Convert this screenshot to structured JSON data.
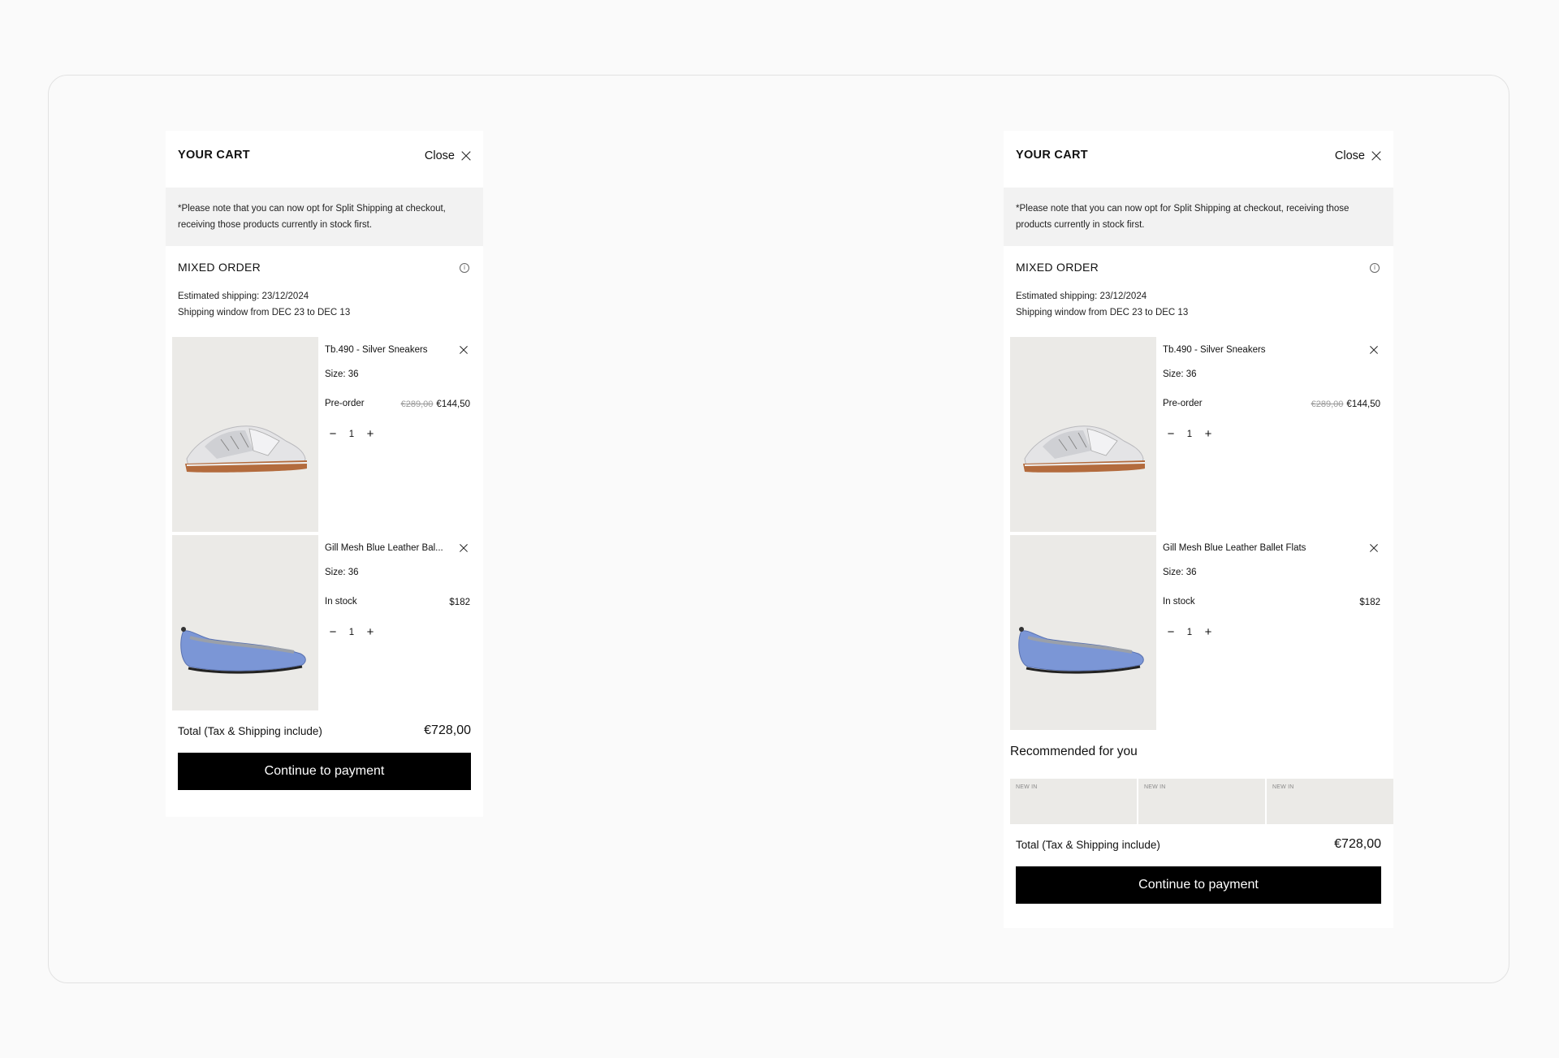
{
  "cart_title": "YOUR CART",
  "close_label": "Close",
  "notice": "*Please note that you can now opt for Split Shipping at checkout, receiving those products currently in stock first.",
  "section_label": "MIXED ORDER",
  "estimated_shipping": "Estimated shipping: 23/12/2024",
  "shipping_window": "Shipping window from DEC 23 to DEC 13",
  "items": [
    {
      "name": "Tb.490 - Silver Sneakers",
      "size": "Size: 36",
      "status": "Pre-order",
      "old_price": "€289,00",
      "price": "€144,50",
      "qty": "1",
      "image_icon": "silver-sneaker-image"
    },
    {
      "name": "Gill Mesh Blue Leather Ballet Flats",
      "name_truncated": "Gill Mesh Blue Leather Bal...",
      "size": "Size: 36",
      "status": "In stock",
      "old_price": "",
      "price": "$182",
      "qty": "1",
      "image_icon": "blue-ballet-flat-image"
    }
  ],
  "qty_minus": "−",
  "qty_plus": "+",
  "recommended": {
    "title": "Recommended for you",
    "cards": [
      "NEW IN",
      "NEW IN",
      "NEW IN"
    ]
  },
  "total_label": "Total (Tax & Shipping include)",
  "total_value": "€728,00",
  "pay_label": "Continue to payment",
  "colors": {
    "background": "#fafafa",
    "notice_bg": "#f2f2f2",
    "button": "#000000",
    "flat_blue": "#7b96d6"
  }
}
